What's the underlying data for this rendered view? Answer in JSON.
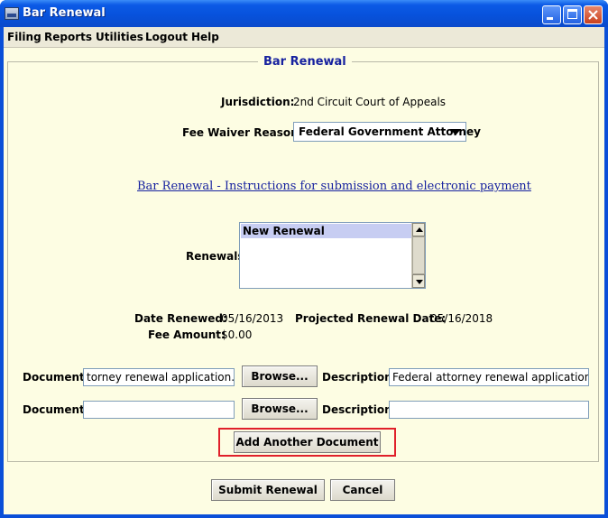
{
  "window": {
    "title": "Bar Renewal"
  },
  "menu": [
    "Filing",
    "Reports",
    "Utilities",
    "Logout",
    "Help"
  ],
  "panel": {
    "title": "Bar Renewal",
    "jurisdiction_label": "Jurisdiction:",
    "jurisdiction_value": "2nd Circuit Court of Appeals",
    "fee_waiver_label": "Fee Waiver Reason:",
    "fee_waiver_selected": "Federal Government Attorney",
    "instructions_link": "Bar Renewal - Instructions for submission and electronic payment",
    "renewals_label": "Renewals",
    "renewals_items": [
      "New Renewal"
    ],
    "date_renewed_label": "Date Renewed:",
    "date_renewed_value": "05/16/2013",
    "projected_label": "Projected Renewal Date:",
    "projected_value": "05/16/2018",
    "fee_amount_label": "Fee Amount:",
    "fee_amount_value": "$0.00"
  },
  "documents": [
    {
      "doc_label": "Document:",
      "doc_value": "torney renewal application.pdf",
      "browse_label": "Browse...",
      "desc_label": "Description:",
      "desc_value": "Federal attorney renewal application"
    },
    {
      "doc_label": "Document:",
      "doc_value": "",
      "browse_label": "Browse...",
      "desc_label": "Description:",
      "desc_value": ""
    }
  ],
  "add_document_label": "Add Another Document",
  "footer": {
    "submit_label": "Submit Renewal",
    "cancel_label": "Cancel"
  },
  "colors": {
    "title_blue": "#17229f",
    "highlight_red": "#e0202a",
    "panel_bg": "#fdfde3"
  }
}
